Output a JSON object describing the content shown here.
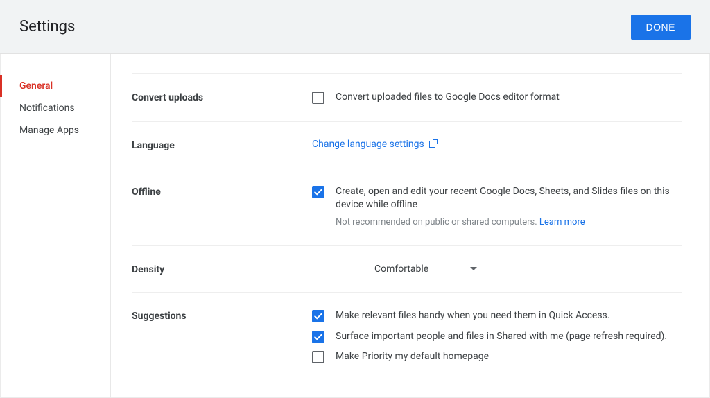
{
  "header": {
    "title": "Settings",
    "done": "DONE"
  },
  "sidebar": {
    "items": [
      {
        "label": "General",
        "active": true
      },
      {
        "label": "Notifications",
        "active": false
      },
      {
        "label": "Manage Apps",
        "active": false
      }
    ]
  },
  "sections": {
    "convert": {
      "label": "Convert uploads",
      "checkbox_text": "Convert uploaded files to Google Docs editor format",
      "checked": false
    },
    "language": {
      "label": "Language",
      "link_text": "Change language settings"
    },
    "offline": {
      "label": "Offline",
      "checkbox_text": "Create, open and edit your recent Google Docs, Sheets, and Slides files on this device while offline",
      "checked": true,
      "hint_prefix": "Not recommended on public or shared computers. ",
      "hint_link": "Learn more"
    },
    "density": {
      "label": "Density",
      "value": "Comfortable"
    },
    "suggestions": {
      "label": "Suggestions",
      "items": [
        {
          "text": "Make relevant files handy when you need them in Quick Access.",
          "checked": true,
          "halo": true
        },
        {
          "text": "Surface important people and files in Shared with me (page refresh required).",
          "checked": true,
          "halo": false
        },
        {
          "text": "Make Priority my default homepage",
          "checked": false,
          "halo": false
        }
      ]
    }
  }
}
